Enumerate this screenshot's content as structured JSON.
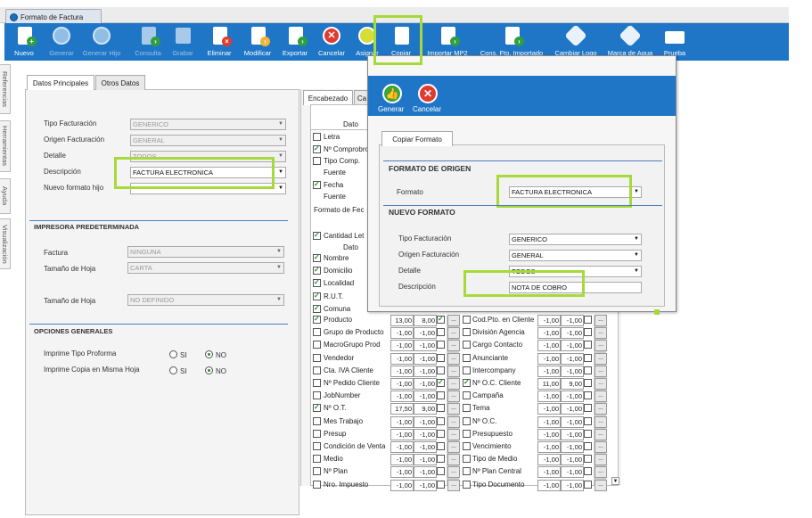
{
  "window": {
    "title": "Formato de Factura"
  },
  "toolbar": {
    "buttons": [
      {
        "label": "Nuevo",
        "icon": "new-doc-icon"
      },
      {
        "label": "Generar",
        "icon": "thumbs-up-icon"
      },
      {
        "label": "Generar Hijo",
        "icon": "thumbs-up-icon"
      },
      {
        "label": "Consulta",
        "icon": "query-doc-icon"
      },
      {
        "label": "Grabar",
        "icon": "save-icon"
      },
      {
        "label": "Eliminar",
        "icon": "delete-doc-icon"
      },
      {
        "label": "Modificar",
        "icon": "edit-doc-icon"
      },
      {
        "label": "Exportar",
        "icon": "export-doc-icon"
      },
      {
        "label": "Cancelar",
        "icon": "cancel-icon"
      },
      {
        "label": "Asignar",
        "icon": "assign-icon"
      },
      {
        "label": "Copiar",
        "icon": "copy-icon"
      },
      {
        "label": "Importar MP2",
        "icon": "import-doc-icon"
      },
      {
        "label": "Cons. Fto. Importado",
        "icon": "import-query-icon"
      },
      {
        "label": "Cambiar Logo",
        "icon": "logo-icon"
      },
      {
        "label": "Marca de Agua",
        "icon": "watermark-icon"
      },
      {
        "label": "Prueba",
        "icon": "printer-icon"
      }
    ]
  },
  "side_tabs": [
    "Referencias",
    "Herramientas",
    "Ayuda",
    "Visualización"
  ],
  "left": {
    "tabs": [
      "Datos Principales",
      "Otros Datos"
    ],
    "fields": {
      "tipo_facturacion": {
        "label": "Tipo Facturación",
        "value": "GENERICO"
      },
      "origen_facturacion": {
        "label": "Origen Facturación",
        "value": "GENERAL"
      },
      "detalle": {
        "label": "Detalle",
        "value": "TODOS"
      },
      "descripcion": {
        "label": "Descripción",
        "value": "FACTURA ELECTRONICA"
      },
      "nuevo_formato_hijo": {
        "label": "Nuevo formato hijo",
        "value": ""
      }
    },
    "impresora": {
      "title": "IMPRESORA PREDETERMINADA",
      "factura": {
        "label": "Factura",
        "value": "NINGUNA"
      },
      "tamano_hoja": {
        "label": "Tamaño de Hoja",
        "value": "CARTA"
      },
      "tamano_hoja2": {
        "label": "Tamaño de Hoja",
        "value": "NO DEFINIDO"
      }
    },
    "opciones": {
      "title": "OPCIONES GENERALES",
      "proforma": {
        "label": "Imprime Tipo Proforma",
        "si": "SI",
        "no": "NO"
      },
      "copia": {
        "label": "Imprime Copia en Misma Hoja",
        "si": "SI",
        "no": "NO"
      }
    }
  },
  "right": {
    "tabs": [
      "Encabezado",
      "Ca"
    ],
    "header_dato": "Dato",
    "header_dato2": "Dato",
    "top_items": [
      {
        "label": "Letra",
        "checked": false
      },
      {
        "label": "Nº Comprobro",
        "checked": true
      },
      {
        "label": "Tipo Comp.",
        "checked": false
      },
      {
        "label": "Fuente",
        "checked": null
      },
      {
        "label": "Fecha",
        "checked": true
      },
      {
        "label": "Fuente",
        "checked": null
      },
      {
        "label": "Formato de Fec",
        "checked": null
      }
    ],
    "cantidad": "Cantidad Let",
    "upper_items": [
      {
        "label": "Nombre",
        "checked": true
      },
      {
        "label": "Domicilio",
        "checked": true
      },
      {
        "label": "Localidad",
        "checked": true
      },
      {
        "label": "R.U.T.",
        "checked": true
      },
      {
        "label": "Comuna",
        "checked": true
      }
    ],
    "rows": [
      {
        "l": "Producto",
        "lc": true,
        "a": "13,00",
        "b": "8,00",
        "bc": true,
        "r": "Cod.Pto. en Cliente",
        "rc": false,
        "c": "-1,00",
        "d": "-1,00"
      },
      {
        "l": "Grupo de Producto",
        "lc": false,
        "a": "-1,00",
        "b": "-1,00",
        "bc": false,
        "r": "División Agencia",
        "rc": false,
        "c": "-1,00",
        "d": "-1,00"
      },
      {
        "l": "MacroGrupo Prod",
        "lc": false,
        "a": "-1,00",
        "b": "-1,00",
        "bc": false,
        "r": "Cargo Contacto",
        "rc": false,
        "c": "-1,00",
        "d": "-1,00"
      },
      {
        "l": "Vendedor",
        "lc": false,
        "a": "-1,00",
        "b": "-1,00",
        "bc": false,
        "r": "Anunciante",
        "rc": false,
        "c": "-1,00",
        "d": "-1,00"
      },
      {
        "l": "Cta. IVA Cliente",
        "lc": false,
        "a": "-1,00",
        "b": "-1,00",
        "bc": false,
        "r": "Intercompany",
        "rc": false,
        "c": "-1,00",
        "d": "-1,00"
      },
      {
        "l": "Nº Pedido Cliente",
        "lc": false,
        "a": "-1,00",
        "b": "-1,00",
        "bc": true,
        "r": "Nº O.C. Cliente",
        "rc": true,
        "c": "11,00",
        "d": "9,00"
      },
      {
        "l": "JobNumber",
        "lc": false,
        "a": "-1,00",
        "b": "-1,00",
        "bc": false,
        "r": "Campaña",
        "rc": false,
        "c": "-1,00",
        "d": "-1,00"
      },
      {
        "l": "Nº O.T.",
        "lc": true,
        "a": "17,50",
        "b": "9,00",
        "bc": false,
        "r": "Tema",
        "rc": false,
        "c": "-1,00",
        "d": "-1,00"
      },
      {
        "l": "Mes Trabajo",
        "lc": false,
        "a": "-1,00",
        "b": "-1,00",
        "bc": false,
        "r": "Nº O.C.",
        "rc": false,
        "c": "-1,00",
        "d": "-1,00"
      },
      {
        "l": "Presup",
        "lc": false,
        "a": "-1,00",
        "b": "-1,00",
        "bc": false,
        "r": "Presupuesto",
        "rc": false,
        "c": "-1,00",
        "d": "-1,00"
      },
      {
        "l": "Condición de Venta",
        "lc": false,
        "a": "-1,00",
        "b": "-1,00",
        "bc": false,
        "r": "Vencimiento",
        "rc": false,
        "c": "-1,00",
        "d": "-1,00"
      },
      {
        "l": "Medio",
        "lc": false,
        "a": "-1,00",
        "b": "-1,00",
        "bc": false,
        "r": "Tipo de Medio",
        "rc": false,
        "c": "-1,00",
        "d": "-1,00"
      },
      {
        "l": "Nº Plan",
        "lc": false,
        "a": "-1,00",
        "b": "-1,00",
        "bc": false,
        "r": "Nº Plan Central",
        "rc": false,
        "c": "-1,00",
        "d": "-1,00"
      },
      {
        "l": "Nro. Impuesto",
        "lc": false,
        "a": "-1,00",
        "b": "-1,00",
        "bc": false,
        "r": "Tipo Documento",
        "rc": false,
        "c": "-1,00",
        "d": "-1,00"
      }
    ],
    "dots_label": "..."
  },
  "dialog": {
    "generar": "Generar",
    "cancelar": "Cancelar",
    "tab": "Copiar Formato",
    "origen_title": "FORMATO DE ORIGEN",
    "formato": {
      "label": "Formato",
      "value": "FACTURA ELECTRONICA"
    },
    "nuevo_title": "NUEVO FORMATO",
    "tipo_facturacion": {
      "label": "Tipo Facturación",
      "value": "GENERICO"
    },
    "origen_facturacion": {
      "label": "Origen Facturación",
      "value": "GENERAL"
    },
    "detalle": {
      "label": "Detalle",
      "value": "TODOS"
    },
    "descripcion": {
      "label": "Descripción",
      "value": "NOTA DE COBRO"
    }
  }
}
